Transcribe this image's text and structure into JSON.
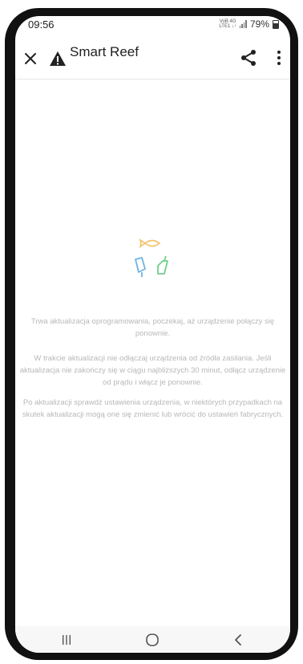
{
  "status_bar": {
    "time": "09:56",
    "network_top": "VoB 4G",
    "network_bottom": "LTE1 ↓↑",
    "battery": "79%"
  },
  "app_bar": {
    "title": "Smart Reef",
    "close_icon": "close-icon",
    "warning_icon": "warning-icon",
    "share_icon": "share-icon",
    "more_icon": "more-vert-icon"
  },
  "loader": {
    "colors": {
      "fish": "#f2c26b",
      "blue": "#6fb3e0",
      "green": "#6fcf8a"
    }
  },
  "messages": [
    "Trwa aktualizacja oprogramowania, poczekaj, aż urządzenie połączy się ponownie.",
    "W trakcie aktualizacji nie odłączaj urządzenia od źródła zasilania. Jeśli aktualizacja nie zakończy się w ciągu najbliższych 30 minut, odłącz urządzenie od prądu i włącz je ponownie.",
    "Po aktualizacji sprawdź ustawienia urządzenia, w niektórych przypadkach na skutek aktualizacji mogą one się zmienić lub wrócić do ustawień fabrycznych."
  ],
  "nav_bar": {
    "recents_icon": "recents-icon",
    "home_icon": "home-icon",
    "back_icon": "back-icon"
  }
}
